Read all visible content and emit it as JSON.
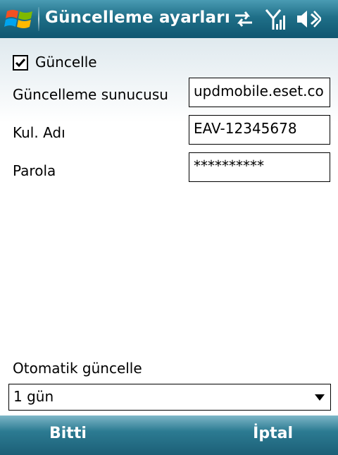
{
  "titlebar": {
    "title": "Güncelleme ayarları",
    "icons": [
      "windows-start-icon",
      "connectivity-icon",
      "signal-icon",
      "volume-icon"
    ]
  },
  "form": {
    "update_checkbox": {
      "label": "Güncelle",
      "checked": true
    },
    "server": {
      "label": "Güncelleme sunucusu",
      "value": "updmobile.eset.co"
    },
    "username": {
      "label": "Kul. Adı",
      "value": "EAV-12345678"
    },
    "password": {
      "label": "Parola",
      "value": "**********"
    },
    "auto_update": {
      "label": "Otomatik güncelle",
      "selected": "1 gün"
    }
  },
  "softkeys": {
    "left": "Bitti",
    "right": "İptal"
  },
  "colors": {
    "titlebar": "#1f6f88",
    "softbar": "#2c7b92",
    "text": "#000000"
  }
}
